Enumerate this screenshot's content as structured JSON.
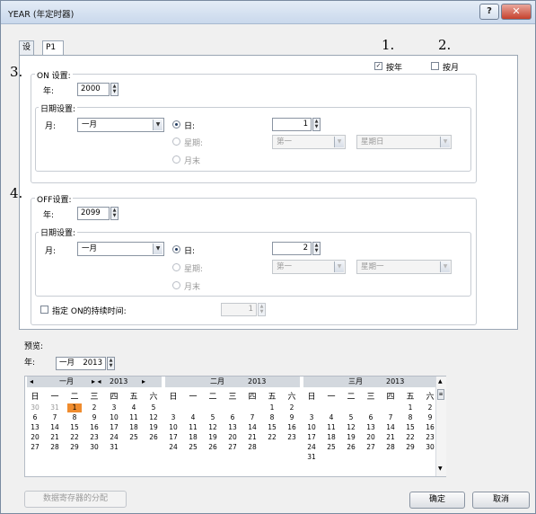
{
  "window": {
    "title": "YEAR (年定时器)",
    "help_glyph": "?",
    "close_glyph": "✕"
  },
  "tabs": [
    {
      "label": "设备"
    },
    {
      "label": "P1"
    }
  ],
  "callouts": [
    "1.",
    "2.",
    "3.",
    "4."
  ],
  "mode": {
    "by_year_label": "按年",
    "by_year_checked": true,
    "by_month_label": "按月",
    "by_month_checked": false
  },
  "on": {
    "group_label": "ON 设置:",
    "year_label": "年:",
    "year_value": "2000",
    "date_group_label": "日期设置:",
    "month_label": "月:",
    "month_value": "一月",
    "day_radio_label": "日:",
    "day_value": "1",
    "week_radio_label": "星期:",
    "week_ordinal": "第一",
    "week_day": "星期日",
    "month_end_label": "月末"
  },
  "off": {
    "group_label": "OFF设置:",
    "year_label": "年:",
    "year_value": "2099",
    "date_group_label": "日期设置:",
    "month_label": "月:",
    "month_value": "一月",
    "day_radio_label": "日:",
    "day_value": "2",
    "week_radio_label": "星期:",
    "week_ordinal": "第一",
    "week_day": "星期一",
    "month_end_label": "月末"
  },
  "duration": {
    "label": "指定 ON的持续时间:",
    "checked": false,
    "value": "1"
  },
  "preview": {
    "label": "预览:",
    "year_label": "年:",
    "month_value": "一月",
    "year_value": "2013"
  },
  "calendars": [
    {
      "nav_prev": "◂",
      "month": "一月",
      "nav_mid": "▸ ◂",
      "year": "2013",
      "nav_next": "▸",
      "weekdays": [
        "日",
        "一",
        "二",
        "三",
        "四",
        "五",
        "六"
      ],
      "rows": [
        [
          "30",
          "31",
          "1",
          "2",
          "3",
          "4",
          "5"
        ],
        [
          "6",
          "7",
          "8",
          "9",
          "10",
          "11",
          "12"
        ],
        [
          "13",
          "14",
          "15",
          "16",
          "17",
          "18",
          "19"
        ],
        [
          "20",
          "21",
          "22",
          "23",
          "24",
          "25",
          "26"
        ],
        [
          "27",
          "28",
          "29",
          "30",
          "31",
          "",
          ""
        ],
        [
          "",
          "",
          "",
          "",
          "",
          "",
          ""
        ]
      ],
      "other_month_days": [
        [
          0,
          0
        ],
        [
          0,
          1
        ]
      ],
      "selected": [
        0,
        2
      ]
    },
    {
      "month": "二月",
      "year": "2013",
      "weekdays": [
        "日",
        "一",
        "二",
        "三",
        "四",
        "五",
        "六"
      ],
      "rows": [
        [
          "",
          "",
          "",
          "",
          "",
          "1",
          "2"
        ],
        [
          "3",
          "4",
          "5",
          "6",
          "7",
          "8",
          "9"
        ],
        [
          "10",
          "11",
          "12",
          "13",
          "14",
          "15",
          "16"
        ],
        [
          "17",
          "18",
          "19",
          "20",
          "21",
          "22",
          "23"
        ],
        [
          "24",
          "25",
          "26",
          "27",
          "28",
          "",
          ""
        ],
        [
          "",
          "",
          "",
          "",
          "",
          "",
          ""
        ]
      ]
    },
    {
      "month": "三月",
      "year": "2013",
      "weekdays": [
        "日",
        "一",
        "二",
        "三",
        "四",
        "五",
        "六"
      ],
      "rows": [
        [
          "",
          "",
          "",
          "",
          "",
          "1",
          "2"
        ],
        [
          "3",
          "4",
          "5",
          "6",
          "7",
          "8",
          "9"
        ],
        [
          "10",
          "11",
          "12",
          "13",
          "14",
          "15",
          "16"
        ],
        [
          "17",
          "18",
          "19",
          "20",
          "21",
          "22",
          "23"
        ],
        [
          "24",
          "25",
          "26",
          "27",
          "28",
          "29",
          "30"
        ],
        [
          "31",
          "",
          "",
          "",
          "",
          "",
          ""
        ]
      ]
    }
  ],
  "buttons": {
    "data_register": "数据寄存器的分配",
    "ok": "确定",
    "cancel": "取消"
  },
  "colors": {
    "selected_day": "#f08c2e",
    "calendar_header": "#d3d8de"
  }
}
